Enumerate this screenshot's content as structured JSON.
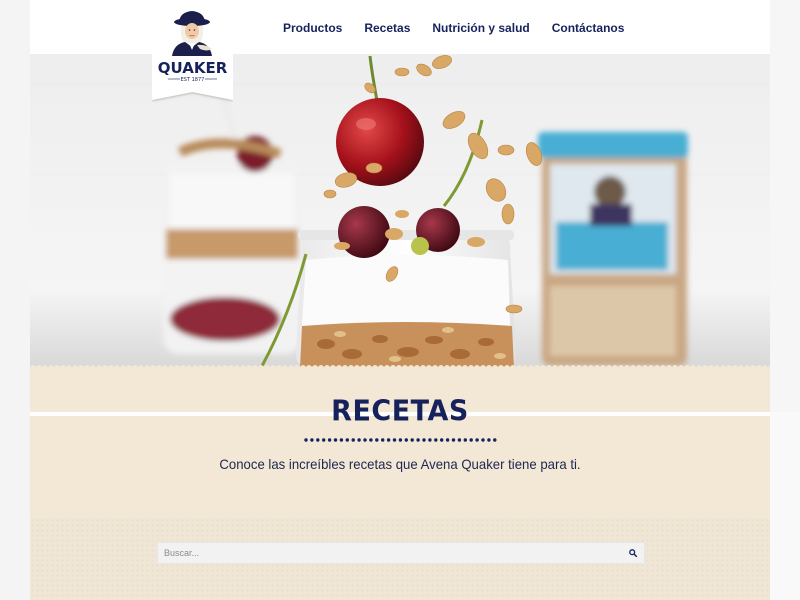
{
  "brand": {
    "logo_text": "QUAKER",
    "logo_sub": "EST 1877",
    "brand_color": "#16225c"
  },
  "nav": {
    "items": [
      {
        "label": "Productos"
      },
      {
        "label": "Recetas"
      },
      {
        "label": "Nutrición y salud"
      },
      {
        "label": "Contáctanos"
      }
    ]
  },
  "hero": {
    "image_subject": "yogurt-parfait-with-cherries-and-granola"
  },
  "recetas": {
    "title": "RECETAS",
    "subtitle": "Conoce las increíbles recetas que Avena Quaker tiene para ti.",
    "background": "#f3e7d5"
  },
  "search": {
    "placeholder": "Buscar...",
    "value": "",
    "icon": "search-icon"
  }
}
